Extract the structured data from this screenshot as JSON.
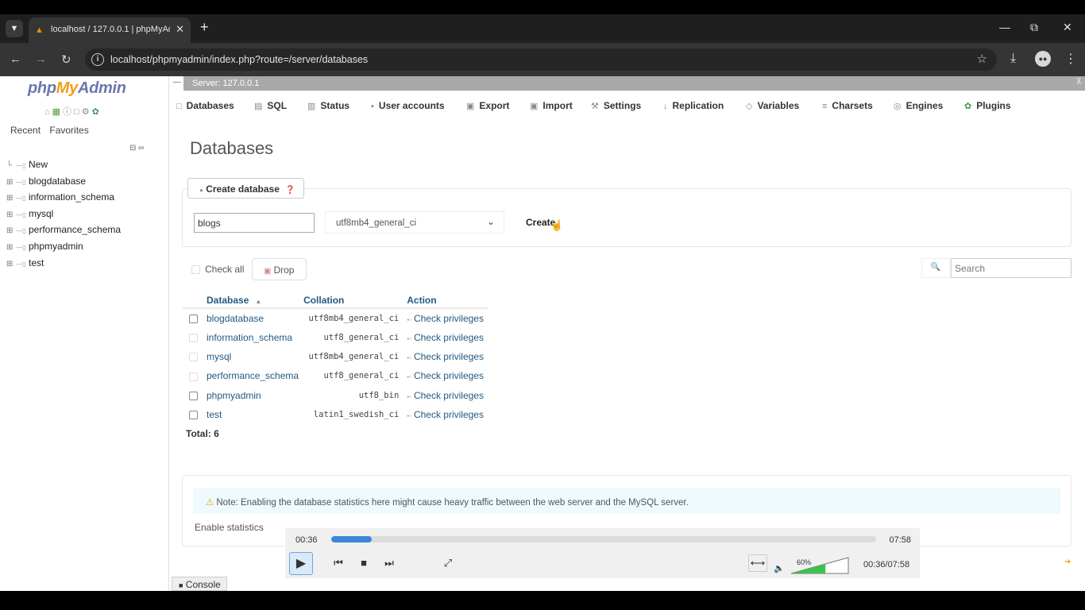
{
  "browser": {
    "tab_title": "localhost / 127.0.0.1 | phpMyAd",
    "url": "localhost/phpmyadmin/index.php?route=/server/databases"
  },
  "leftnav": {
    "logo_php": "php",
    "logo_my": "My",
    "logo_admin": "Admin",
    "recent": "Recent",
    "favorites": "Favorites",
    "tree": [
      {
        "label": "New"
      },
      {
        "label": "blogdatabase"
      },
      {
        "label": "information_schema"
      },
      {
        "label": "mysql"
      },
      {
        "label": "performance_schema"
      },
      {
        "label": "phpmyadmin"
      },
      {
        "label": "test"
      }
    ]
  },
  "serverbar": {
    "label": "Server: 127.0.0.1"
  },
  "menu": {
    "tabs": [
      {
        "label": "Databases",
        "icon": "database-icon"
      },
      {
        "label": "SQL",
        "icon": "sql-icon"
      },
      {
        "label": "Status",
        "icon": "status-icon"
      },
      {
        "label": "User accounts",
        "icon": "user-accounts-icon"
      },
      {
        "label": "Export",
        "icon": "export-icon"
      },
      {
        "label": "Import",
        "icon": "import-icon"
      },
      {
        "label": "Settings",
        "icon": "wrench-icon"
      },
      {
        "label": "Replication",
        "icon": "replication-icon"
      },
      {
        "label": "Variables",
        "icon": "variables-icon"
      },
      {
        "label": "Charsets",
        "icon": "charsets-icon"
      },
      {
        "label": "Engines",
        "icon": "engines-icon"
      },
      {
        "label": "Plugins",
        "icon": "puzzle-icon"
      }
    ]
  },
  "main": {
    "heading": "Databases",
    "create": {
      "legend": "Create database",
      "name_value": "blogs",
      "collation_value": "utf8mb4_general_ci",
      "button": "Create"
    },
    "check_all": "Check all",
    "drop": "Drop",
    "search_placeholder": "Search",
    "table": {
      "headers": [
        "Database",
        "Collation",
        "Action"
      ],
      "rows": [
        {
          "name": "blogdatabase",
          "collation": "utf8mb4_general_ci",
          "action": "Check privileges"
        },
        {
          "name": "information_schema",
          "collation": "utf8_general_ci",
          "action": "Check privileges"
        },
        {
          "name": "mysql",
          "collation": "utf8mb4_general_ci",
          "action": "Check privileges"
        },
        {
          "name": "performance_schema",
          "collation": "utf8_general_ci",
          "action": "Check privileges"
        },
        {
          "name": "phpmyadmin",
          "collation": "utf8_bin",
          "action": "Check privileges"
        },
        {
          "name": "test",
          "collation": "latin1_swedish_ci",
          "action": "Check privileges"
        }
      ]
    },
    "total": "Total: 6",
    "note": "Note: Enabling the database statistics here might cause heavy traffic between the web server and the MySQL server.",
    "enable_stats": "Enable statistics",
    "console": "Console"
  },
  "player": {
    "elapsed": "00:36",
    "duration": "07:58",
    "progress_fraction": 0.075,
    "volume_percent": 60,
    "volume_label": "60%",
    "combo_time": "00:36/07:58",
    "accent_color": "#3b86d8"
  }
}
